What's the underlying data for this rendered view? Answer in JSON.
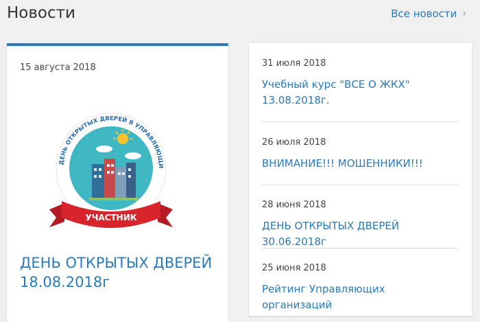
{
  "header": {
    "title": "Новости",
    "all_news_label": "Все новости"
  },
  "featured": {
    "date": "15 августа 2018",
    "title": "ДЕНЬ ОТКРЫТЫХ ДВЕРЕЙ 18.08.2018г",
    "emblem": {
      "arc_text": "ДЕНЬ ОТКРЫТЫХ ДВЕРЕЙ В УПРАВЛЯЮЩИХ КОМПАНИЯХ ПОДМОСКОВЬЯ",
      "ribbon_text": "УЧАСТНИК"
    }
  },
  "news": [
    {
      "date": "31 июля 2018",
      "title": "Учебный курс \"ВСЕ О ЖКХ\" 13.08.2018г."
    },
    {
      "date": "26 июля 2018",
      "title": "ВНИМАНИЕ!!! МОШЕННИКИ!!!"
    },
    {
      "date": "28 июня 2018",
      "title": "ДЕНЬ ОТКРЫТЫХ ДВЕРЕЙ 30.06.2018г"
    },
    {
      "date": "25 июня 2018",
      "title": "Рейтинг Управляющих организаций"
    }
  ],
  "colors": {
    "accent": "#2a7ab8",
    "ribbon": "#d8252c",
    "emblem_circle": "#3fb8c4"
  }
}
